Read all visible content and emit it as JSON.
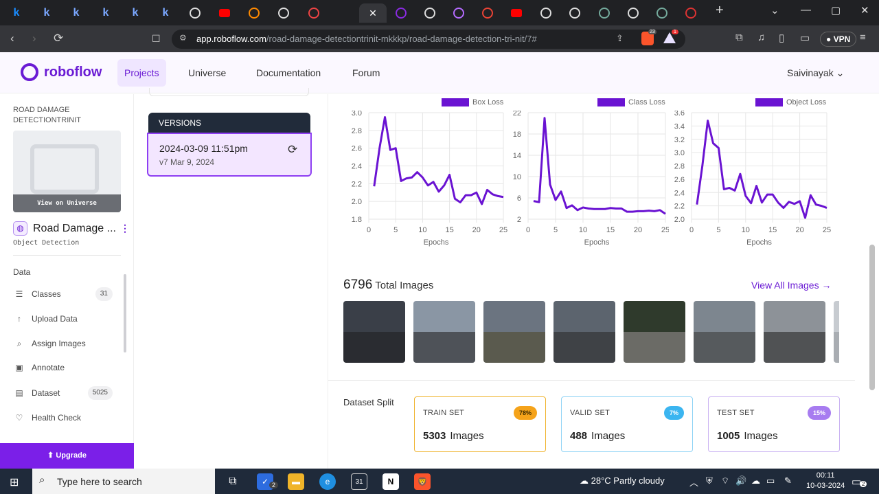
{
  "browser": {
    "tabs": [
      {
        "icon": "k",
        "color": "#1a8cff"
      },
      {
        "icon": "k",
        "color": "#7aa7ff"
      },
      {
        "icon": "k",
        "color": "#7aa7ff"
      },
      {
        "icon": "k",
        "color": "#7aa7ff"
      },
      {
        "icon": "k",
        "color": "#7aa7ff"
      },
      {
        "icon": "k",
        "color": "#7aa7ff"
      },
      {
        "icon": "github",
        "color": "#ddd"
      },
      {
        "icon": "youtube",
        "color": "#ff0000"
      },
      {
        "icon": "infinity",
        "color": "#ff8a00"
      },
      {
        "icon": "openai",
        "color": "#ddd"
      },
      {
        "icon": "gmail-like",
        "color": "#e44"
      },
      {
        "icon": "close",
        "color": "#fff"
      },
      {
        "icon": "roboflow",
        "color": "#8a2be2"
      },
      {
        "icon": "github",
        "color": "#ddd"
      },
      {
        "icon": "bars",
        "color": "#b56bff"
      },
      {
        "icon": "gmail",
        "color": "#ea4335"
      },
      {
        "icon": "youtube",
        "color": "#ff0000"
      },
      {
        "icon": "github",
        "color": "#ddd"
      },
      {
        "icon": "github",
        "color": "#ddd"
      },
      {
        "icon": "chatgpt",
        "color": "#74aa9c"
      },
      {
        "icon": "github",
        "color": "#ddd"
      },
      {
        "icon": "chatgpt",
        "color": "#74aa9c"
      },
      {
        "icon": "badge",
        "color": "#d33"
      }
    ],
    "url_host": "app.roboflow.com",
    "url_path": "/road-damage-detectiontrinit-mkkkp/road-damage-detection-tri-nit/7#",
    "vpn_label": "VPN",
    "brave_count": "23",
    "alert_count": "1"
  },
  "header": {
    "brand": "roboflow",
    "nav": [
      "Projects",
      "Universe",
      "Documentation",
      "Forum"
    ],
    "user": "Saivinayak"
  },
  "sidebar": {
    "workspace": "ROAD DAMAGE DETECTIONTRINIT",
    "view_on_universe": "View on Universe",
    "project_title": "Road Damage ...",
    "project_type": "Object Detection",
    "section": "Data",
    "items": [
      {
        "label": "Classes",
        "icon": "list-icon",
        "badge": "31"
      },
      {
        "label": "Upload Data",
        "icon": "upload-icon",
        "badge": ""
      },
      {
        "label": "Assign Images",
        "icon": "search-icon",
        "badge": ""
      },
      {
        "label": "Annotate",
        "icon": "annotate-icon",
        "badge": ""
      },
      {
        "label": "Dataset",
        "icon": "dataset-icon",
        "badge": "5025"
      },
      {
        "label": "Health Check",
        "icon": "heart-icon",
        "badge": ""
      }
    ],
    "upgrade": "Upgrade"
  },
  "versions": {
    "header": "VERSIONS",
    "date": "2024-03-09 11:51pm",
    "sub": "v7 Mar 9, 2024"
  },
  "main": {
    "total_images": "6796",
    "total_label": "Total Images",
    "view_all": "View All Images →",
    "split_label": "Dataset Split",
    "sets": [
      {
        "name": "TRAIN SET",
        "pct": "78%",
        "count": "5303",
        "unit": "Images",
        "border": "#f0b430",
        "badge_bg": "#f5a31a",
        "badge_fg": "#3a2a00"
      },
      {
        "name": "VALID SET",
        "pct": "7%",
        "count": "488",
        "unit": "Images",
        "border": "#8fd3f5",
        "badge_bg": "#3bb5f0",
        "badge_fg": "#ffffff"
      },
      {
        "name": "TEST SET",
        "pct": "15%",
        "count": "1005",
        "unit": "Images",
        "border": "#c9b1f2",
        "badge_bg": "#a77cf0",
        "badge_fg": "#ffffff"
      }
    ]
  },
  "chart_data": [
    {
      "type": "line",
      "title": "",
      "series": [
        {
          "name": "Box Loss",
          "values": [
            2.17,
            2.6,
            2.95,
            2.58,
            2.6,
            2.23,
            2.26,
            2.27,
            2.33,
            2.27,
            2.18,
            2.22,
            2.11,
            2.18,
            2.3,
            2.03,
            1.99,
            2.07,
            2.07,
            2.1,
            1.97,
            2.13,
            2.08,
            2.06,
            2.05
          ]
        }
      ],
      "x": [
        1,
        2,
        3,
        4,
        5,
        6,
        7,
        8,
        9,
        10,
        11,
        12,
        13,
        14,
        15,
        16,
        17,
        18,
        19,
        20,
        21,
        22,
        23,
        24,
        25
      ],
      "xlabel": "Epochs",
      "ylabel": "",
      "xlim": [
        0,
        25
      ],
      "ylim": [
        1.8,
        3.0
      ],
      "xticks": [
        0,
        5,
        10,
        15,
        20,
        25
      ],
      "yticks": [
        1.8,
        2.0,
        2.2,
        2.4,
        2.6,
        2.8,
        3.0
      ],
      "color": "#6a13d2",
      "grid": true,
      "legend": "top-right"
    },
    {
      "type": "line",
      "title": "",
      "series": [
        {
          "name": "Class Loss",
          "values": [
            5.4,
            5.2,
            21,
            8.5,
            5.6,
            7.2,
            4.1,
            4.6,
            3.7,
            4.2,
            4.0,
            3.9,
            3.9,
            3.9,
            4.1,
            4.0,
            4.0,
            3.4,
            3.4,
            3.5,
            3.5,
            3.6,
            3.5,
            3.7,
            3.0
          ]
        }
      ],
      "x": [
        1,
        2,
        3,
        4,
        5,
        6,
        7,
        8,
        9,
        10,
        11,
        12,
        13,
        14,
        15,
        16,
        17,
        18,
        19,
        20,
        21,
        22,
        23,
        24,
        25
      ],
      "xlabel": "Epochs",
      "ylabel": "",
      "xlim": [
        0,
        25
      ],
      "ylim": [
        2,
        22
      ],
      "xticks": [
        0,
        5,
        10,
        15,
        20,
        25
      ],
      "yticks": [
        2,
        6,
        10,
        14,
        18,
        22
      ],
      "color": "#6a13d2",
      "grid": true,
      "legend": "top-right"
    },
    {
      "type": "line",
      "title": "",
      "series": [
        {
          "name": "Object Loss",
          "values": [
            2.22,
            2.8,
            3.48,
            3.14,
            3.07,
            2.45,
            2.47,
            2.43,
            2.68,
            2.35,
            2.24,
            2.5,
            2.25,
            2.37,
            2.37,
            2.25,
            2.17,
            2.26,
            2.23,
            2.27,
            2.02,
            2.36,
            2.22,
            2.2,
            2.17
          ]
        }
      ],
      "x": [
        1,
        2,
        3,
        4,
        5,
        6,
        7,
        8,
        9,
        10,
        11,
        12,
        13,
        14,
        15,
        16,
        17,
        18,
        19,
        20,
        21,
        22,
        23,
        24,
        25
      ],
      "xlabel": "Epochs",
      "ylabel": "",
      "xlim": [
        0,
        25
      ],
      "ylim": [
        2.0,
        3.6
      ],
      "xticks": [
        0,
        5,
        10,
        15,
        20,
        25
      ],
      "yticks": [
        2.0,
        2.2,
        2.4,
        2.6,
        2.8,
        3.0,
        3.2,
        3.4,
        3.6
      ],
      "color": "#6a13d2",
      "grid": true,
      "legend": "top-right"
    }
  ],
  "thumbnails": [
    {
      "sky": "#3a3f48",
      "road": "#2a2c31"
    },
    {
      "sky": "#8a96a4",
      "road": "#4e5258"
    },
    {
      "sky": "#6b7480",
      "road": "#5a5a4e"
    },
    {
      "sky": "#5c646e",
      "road": "#3f4246"
    },
    {
      "sky": "#2f3a2c",
      "road": "#6b6b66"
    },
    {
      "sky": "#7d868f",
      "road": "#565a5d"
    },
    {
      "sky": "#8d9298",
      "road": "#505254"
    },
    {
      "sky": "#c7cbd0",
      "road": "#a9adb2"
    }
  ],
  "taskbar": {
    "search_placeholder": "Type here to search",
    "weather": "28°C  Partly cloudy",
    "time": "00:11",
    "date": "10-03-2024",
    "todo_count": "2",
    "notif_count": "2"
  }
}
